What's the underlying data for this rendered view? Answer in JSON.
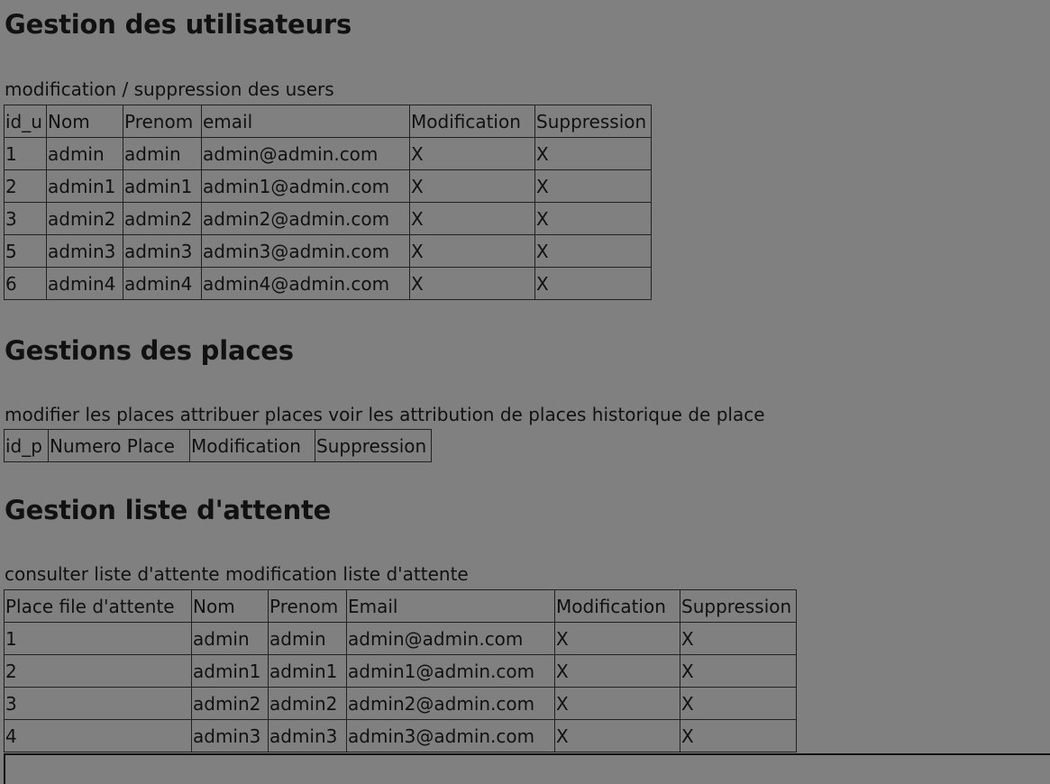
{
  "users_section": {
    "title": "Gestion des utilisateurs",
    "subtitle": "modification / suppression des users",
    "headers": [
      "id_u",
      "Nom",
      "Prenom",
      "email",
      "Modification",
      "Suppression"
    ],
    "rows": [
      [
        "1",
        "admin",
        "admin",
        "admin@admin.com",
        "X",
        "X"
      ],
      [
        "2",
        "admin1",
        "admin1",
        "admin1@admin.com",
        "X",
        "X"
      ],
      [
        "3",
        "admin2",
        "admin2",
        "admin2@admin.com",
        "X",
        "X"
      ],
      [
        "5",
        "admin3",
        "admin3",
        "admin3@admin.com",
        "X",
        "X"
      ],
      [
        "6",
        "admin4",
        "admin4",
        "admin4@admin.com",
        "X",
        "X"
      ]
    ]
  },
  "places_section": {
    "title": "Gestions des places",
    "subtitle": "modifier les places attribuer places voir les attribution de places historique de place",
    "headers": [
      "id_p",
      "Numero Place",
      "Modification",
      "Suppression"
    ]
  },
  "waitlist_section": {
    "title": "Gestion liste d'attente",
    "subtitle": "consulter liste d'attente modification liste d'attente",
    "headers": [
      "Place file d'attente",
      "Nom",
      "Prenom",
      "Email",
      "Modification",
      "Suppression"
    ],
    "rows": [
      [
        "1",
        "admin",
        "admin",
        "admin@admin.com",
        "X",
        "X"
      ],
      [
        "2",
        "admin1",
        "admin1",
        "admin1@admin.com",
        "X",
        "X"
      ],
      [
        "3",
        "admin2",
        "admin2",
        "admin2@admin.com",
        "X",
        "X"
      ],
      [
        "4",
        "admin3",
        "admin3",
        "admin3@admin.com",
        "X",
        "X"
      ]
    ]
  }
}
